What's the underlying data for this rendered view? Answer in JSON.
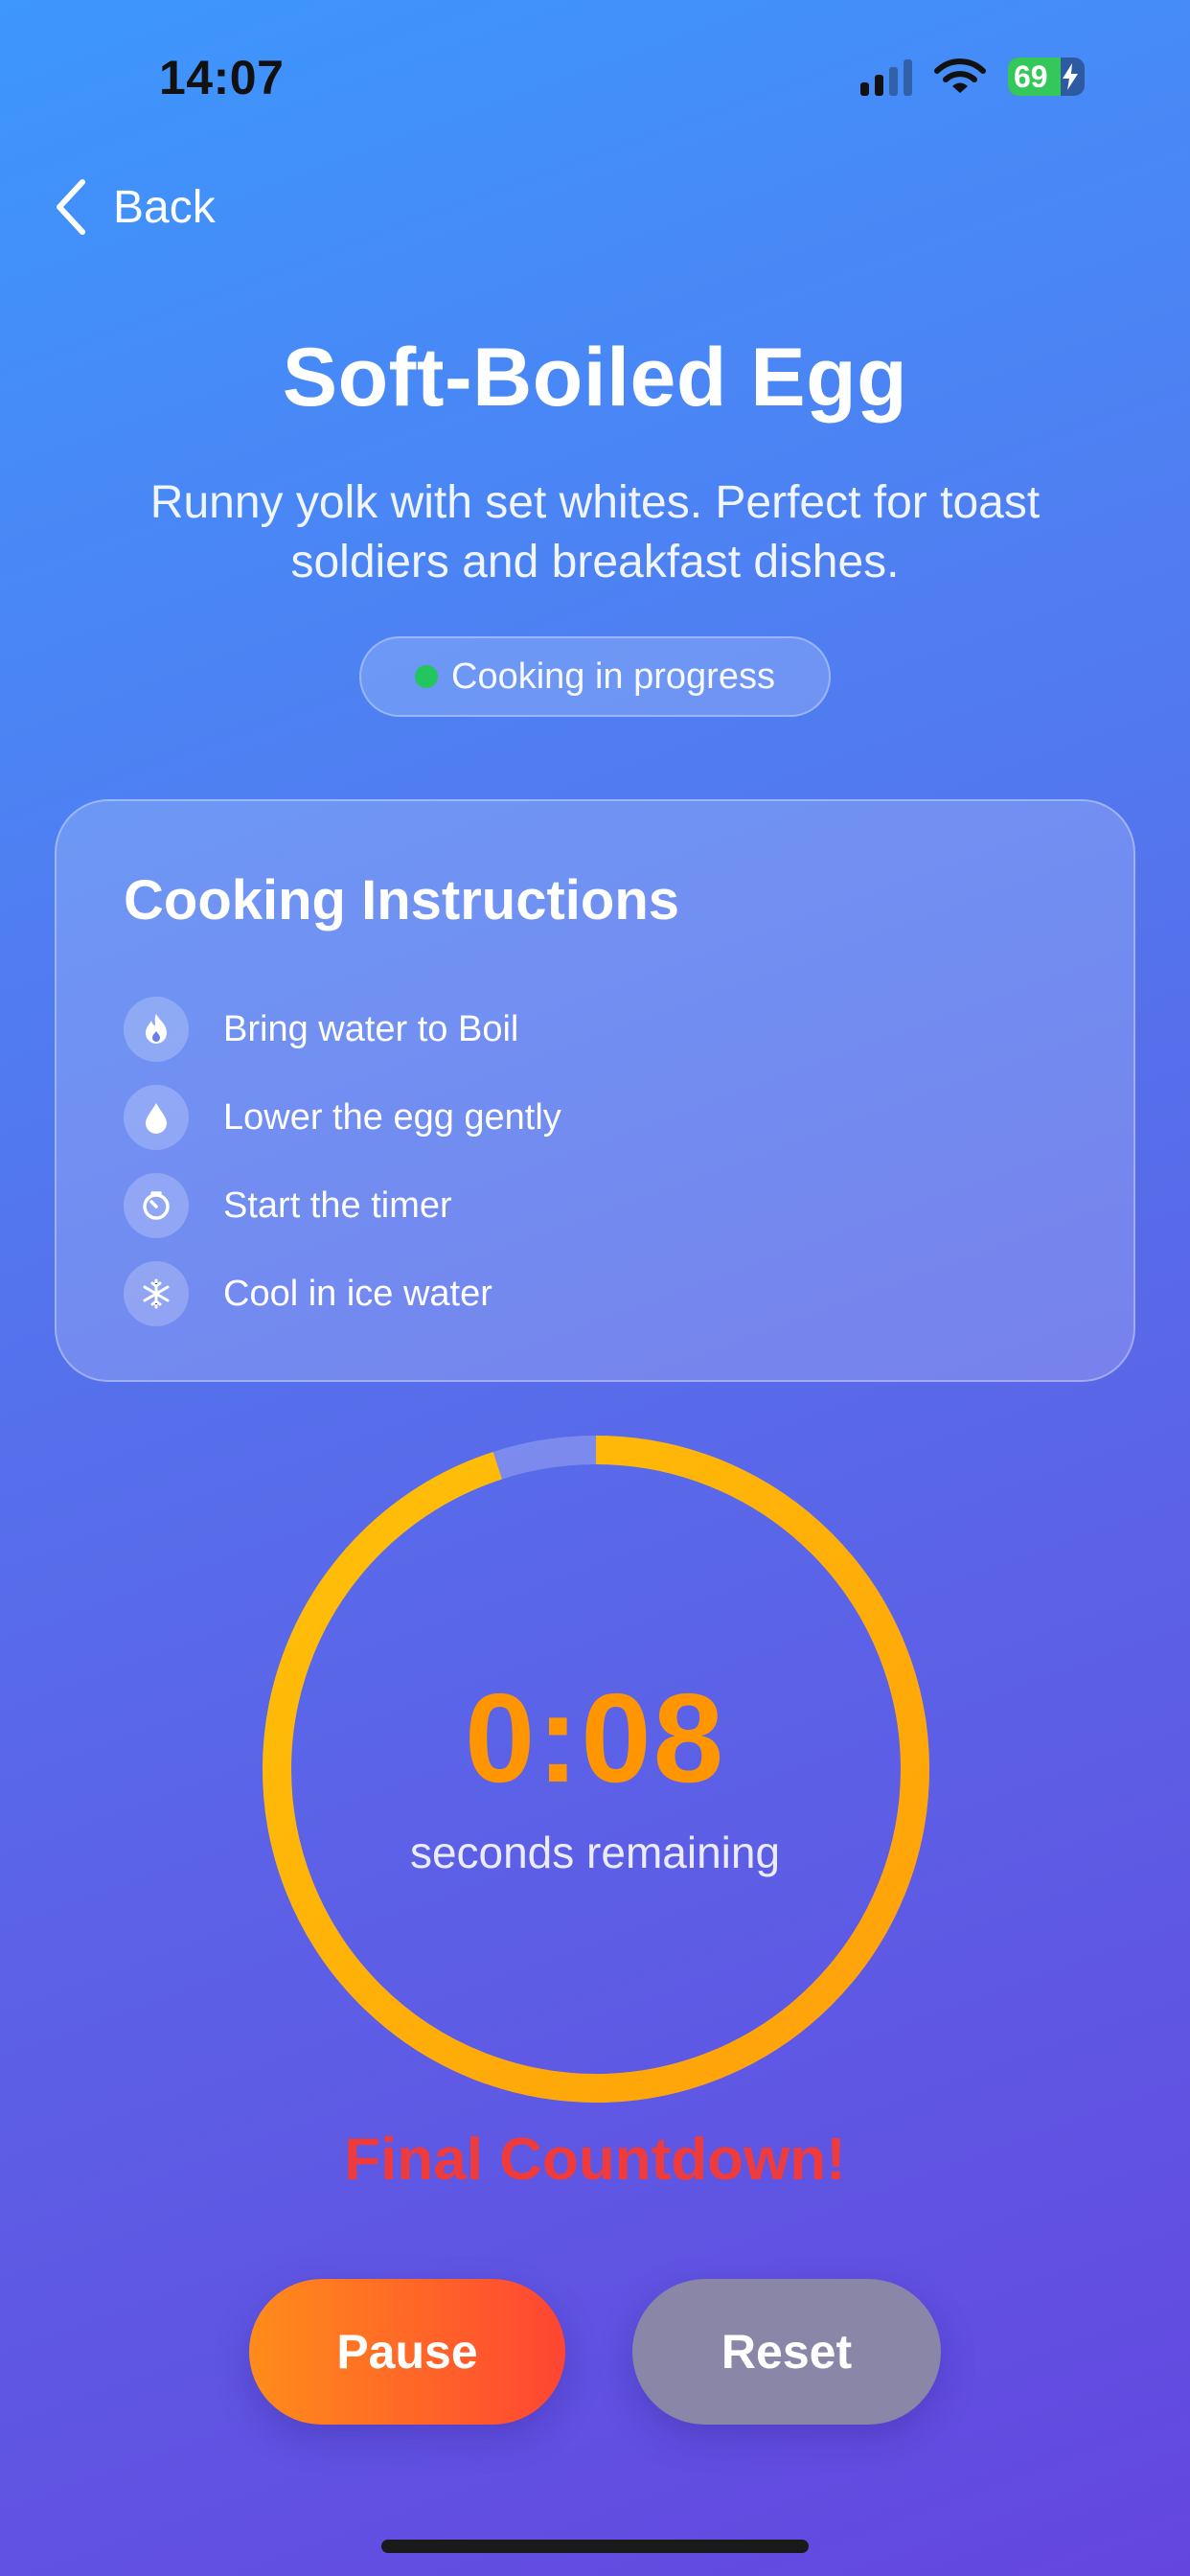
{
  "status_bar": {
    "time": "14:07",
    "battery": "69",
    "battery_percent": 69,
    "signal_bars_active": 2,
    "signal_bars_total": 4
  },
  "nav": {
    "back_label": "Back"
  },
  "header": {
    "title": "Soft-Boiled Egg",
    "description": "Runny yolk with set whites. Perfect for toast soldiers and breakfast dishes.",
    "status": "Cooking in progress",
    "status_color": "#22c55e"
  },
  "instructions": {
    "title": "Cooking Instructions",
    "steps": [
      {
        "label": "Bring water to Boil",
        "icon": "flame-icon"
      },
      {
        "label": "Lower the egg gently",
        "icon": "droplet-icon"
      },
      {
        "label": "Start the timer",
        "icon": "timer-icon"
      },
      {
        "label": "Cool in ice water",
        "icon": "snowflake-icon"
      }
    ]
  },
  "timer": {
    "value": "0:08",
    "caption": "seconds remaining",
    "progress_fraction": 0.95,
    "ring_colors": [
      "#ff9f0a",
      "#ffc107"
    ],
    "alert": "Final Countdown!",
    "alert_color": "#ef3b3b"
  },
  "actions": {
    "pause_label": "Pause",
    "reset_label": "Reset"
  }
}
